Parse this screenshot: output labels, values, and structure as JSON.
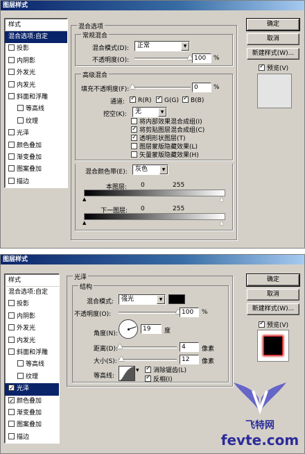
{
  "dialog1": {
    "title": "图层样式",
    "styles_header": "样式",
    "styles": [
      {
        "label": "混合选项:自定",
        "selected": true,
        "checkbox": false,
        "checked": false,
        "sub": false
      },
      {
        "label": "投影",
        "selected": false,
        "checkbox": true,
        "checked": false,
        "sub": false
      },
      {
        "label": "内阴影",
        "selected": false,
        "checkbox": true,
        "checked": false,
        "sub": false
      },
      {
        "label": "外发光",
        "selected": false,
        "checkbox": true,
        "checked": false,
        "sub": false
      },
      {
        "label": "内发光",
        "selected": false,
        "checkbox": true,
        "checked": false,
        "sub": false
      },
      {
        "label": "斜面和浮雕",
        "selected": false,
        "checkbox": true,
        "checked": false,
        "sub": false
      },
      {
        "label": "等高线",
        "selected": false,
        "checkbox": true,
        "checked": false,
        "sub": true
      },
      {
        "label": "纹理",
        "selected": false,
        "checkbox": true,
        "checked": false,
        "sub": true
      },
      {
        "label": "光泽",
        "selected": false,
        "checkbox": true,
        "checked": false,
        "sub": false
      },
      {
        "label": "颜色叠加",
        "selected": false,
        "checkbox": true,
        "checked": false,
        "sub": false
      },
      {
        "label": "渐变叠加",
        "selected": false,
        "checkbox": true,
        "checked": false,
        "sub": false
      },
      {
        "label": "图案叠加",
        "selected": false,
        "checkbox": true,
        "checked": false,
        "sub": false
      },
      {
        "label": "描边",
        "selected": false,
        "checkbox": true,
        "checked": false,
        "sub": false
      }
    ],
    "blend_options_title": "混合选项",
    "general_blend_title": "常规混合",
    "blend_mode_label": "混合模式(D):",
    "blend_mode_value": "正常",
    "opacity_label": "不透明度(O):",
    "opacity_value": "100",
    "percent": "%",
    "advanced_title": "高级混合",
    "fill_opacity_label": "填充不透明度(F):",
    "fill_opacity_value": "0",
    "channels_label": "通道:",
    "channel_r": "R(R)",
    "channel_g": "G(G)",
    "channel_b": "B(B)",
    "knockout_label": "挖空(K):",
    "knockout_value": "无",
    "options": [
      {
        "label": "将内部效果混合成组(I)",
        "checked": false
      },
      {
        "label": "将剪贴图层混合成组(C)",
        "checked": true
      },
      {
        "label": "透明形状图层(T)",
        "checked": true
      },
      {
        "label": "图层蒙版隐藏效果(L)",
        "checked": false
      },
      {
        "label": "矢量蒙版隐藏效果(H)",
        "checked": false
      }
    ],
    "blend_if_label": "混合颜色带(E):",
    "blend_if_value": "灰色",
    "this_layer_label": "本图层:",
    "under_layer_label": "下一图层:",
    "range_min": "0",
    "range_max": "255",
    "btn_ok": "确定",
    "btn_cancel": "取消",
    "btn_new_style": "新建样式(W)...",
    "preview_label": "预览(V)"
  },
  "dialog2": {
    "title": "图层样式",
    "styles_header": "样式",
    "styles": [
      {
        "label": "混合选项:自定",
        "selected": false,
        "checkbox": false,
        "checked": false,
        "sub": false
      },
      {
        "label": "投影",
        "selected": false,
        "checkbox": true,
        "checked": false,
        "sub": false
      },
      {
        "label": "内阴影",
        "selected": false,
        "checkbox": true,
        "checked": false,
        "sub": false
      },
      {
        "label": "外发光",
        "selected": false,
        "checkbox": true,
        "checked": false,
        "sub": false
      },
      {
        "label": "内发光",
        "selected": false,
        "checkbox": true,
        "checked": false,
        "sub": false
      },
      {
        "label": "斜面和浮雕",
        "selected": false,
        "checkbox": true,
        "checked": false,
        "sub": false
      },
      {
        "label": "等高线",
        "selected": false,
        "checkbox": true,
        "checked": false,
        "sub": true
      },
      {
        "label": "纹理",
        "selected": false,
        "checkbox": true,
        "checked": false,
        "sub": true
      },
      {
        "label": "光泽",
        "selected": true,
        "checkbox": true,
        "checked": true,
        "sub": false
      },
      {
        "label": "颜色叠加",
        "selected": false,
        "checkbox": true,
        "checked": true,
        "sub": false
      },
      {
        "label": "渐变叠加",
        "selected": false,
        "checkbox": true,
        "checked": false,
        "sub": false
      },
      {
        "label": "图案叠加",
        "selected": false,
        "checkbox": true,
        "checked": false,
        "sub": false
      },
      {
        "label": "描边",
        "selected": false,
        "checkbox": true,
        "checked": false,
        "sub": false
      }
    ],
    "satin_title": "光泽",
    "structure_title": "结构",
    "blend_mode_label": "混合模式:",
    "blend_mode_value": "强光",
    "swatch_color": "#000000",
    "opacity_label": "不透明度(O):",
    "opacity_value": "100",
    "percent": "%",
    "angle_label": "角度(N):",
    "angle_value": "19",
    "degree": "度",
    "distance_label": "距离(D):",
    "distance_value": "4",
    "size_label": "大小(S):",
    "size_value": "12",
    "px": "像素",
    "contour_label": "等高线:",
    "antialias_label": "消除锯齿(L)",
    "invert_label": "反相(I)",
    "btn_ok": "确定",
    "btn_cancel": "取消",
    "btn_new_style": "新建样式(W)...",
    "preview_label": "预览(V)",
    "preview_color": "#8b0000"
  },
  "watermark": {
    "logo_text": "飞特网",
    "url": "fevte.com"
  },
  "colors": {
    "dialog_bg": "#d4d0c8",
    "title_bar": "#0a246a",
    "selection": "#0a246a",
    "watermark": "#2b2b9a"
  },
  "icons": [
    "checkbox-icon",
    "dropdown-arrow-icon",
    "slider-thumb-icon",
    "angle-dial-icon",
    "contour-curve-icon",
    "wing-logo-icon"
  ]
}
